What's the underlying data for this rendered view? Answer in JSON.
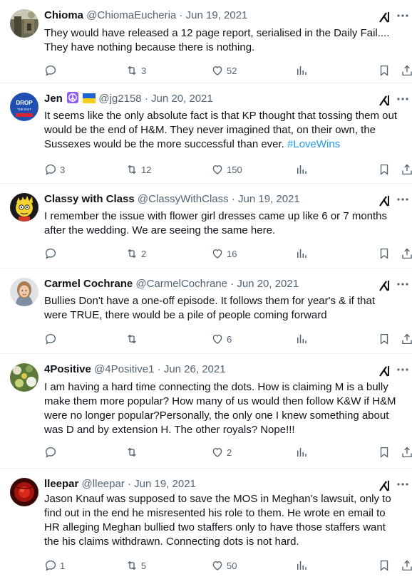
{
  "tweets": [
    {
      "name": "Chioma",
      "handle": "@ChiomaEucheria",
      "date": "Jun 19, 2021",
      "lines": [
        "They would have released a 12 page report, serialised in the Daily Fail....",
        "They have nothing because there is nothing."
      ],
      "replies": "",
      "retweets": "3",
      "likes": "52"
    },
    {
      "name": "Jen",
      "emoji": [
        "peace-symbol",
        "ukraine-flag"
      ],
      "handle": "@jg2158",
      "date": "Jun 20, 2021",
      "lines": [
        "It seems like the only absolute fact is that KP thought that tossing them out",
        "would be the end of H&M. They never imagined that, on their own, the",
        "Sussexes would be the more successful than ever."
      ],
      "hashtag": "#LoveWins",
      "avatar_text": [
        "DROP",
        "THE BAIT"
      ],
      "replies": "3",
      "retweets": "12",
      "likes": "150"
    },
    {
      "name": "Classy with Class",
      "handle": "@ClassyWithClass",
      "date": "Jun 19, 2021",
      "lines": [
        "I remember the issue with flower girl dresses came up like 6 or 7 months",
        "after the wedding.  We are seeing the same here."
      ],
      "replies": "",
      "retweets": "2",
      "likes": "16"
    },
    {
      "name": "Carmel Cochrane",
      "handle": "@CarmelCochrane",
      "date": "Jun 20, 2021",
      "lines": [
        "Bullies Don't have a one-off episode. It follows them for year's & if that",
        "were TRUE, there would be a pile of people coming forward"
      ],
      "replies": "",
      "retweets": "",
      "likes": "6"
    },
    {
      "name": "4Positive",
      "handle": "@4Positive1",
      "date": "Jun 26, 2021",
      "lines": [
        "I am having a hard time connecting the dots. How is claiming M is a bully",
        "make them more popular? How many of us would then follow K&W if H&M",
        "were no longer popular?Personally, the only one I knew something about",
        "was D and by extension H. The other royals? Nope!!!"
      ],
      "replies": "",
      "retweets": "",
      "likes": "2"
    },
    {
      "name": "lleepar",
      "handle": "@lleepar",
      "date": "Jun 19, 2021",
      "lines": [
        "Jason Knauf was supposed to save the MOS in Meghan’s lawsuit, only to",
        "find out in the end he misresented his role to them.  He wrote en email to",
        "HR alleging Meghan bullied two staffers only to have those staffers want",
        "the his claims withdrawn.  Connecting dots is not hard."
      ],
      "replies": "1",
      "retweets": "5",
      "likes": "50"
    }
  ],
  "separator": "·",
  "colors": {
    "text": "#0f1419",
    "muted": "#536471",
    "link": "#1d9bf0",
    "divider": "#eff3f4"
  },
  "icons": [
    "avatar",
    "grok-icon",
    "more-icon",
    "reply-icon",
    "retweet-icon",
    "like-icon",
    "views-icon",
    "bookmark-icon",
    "share-icon"
  ]
}
